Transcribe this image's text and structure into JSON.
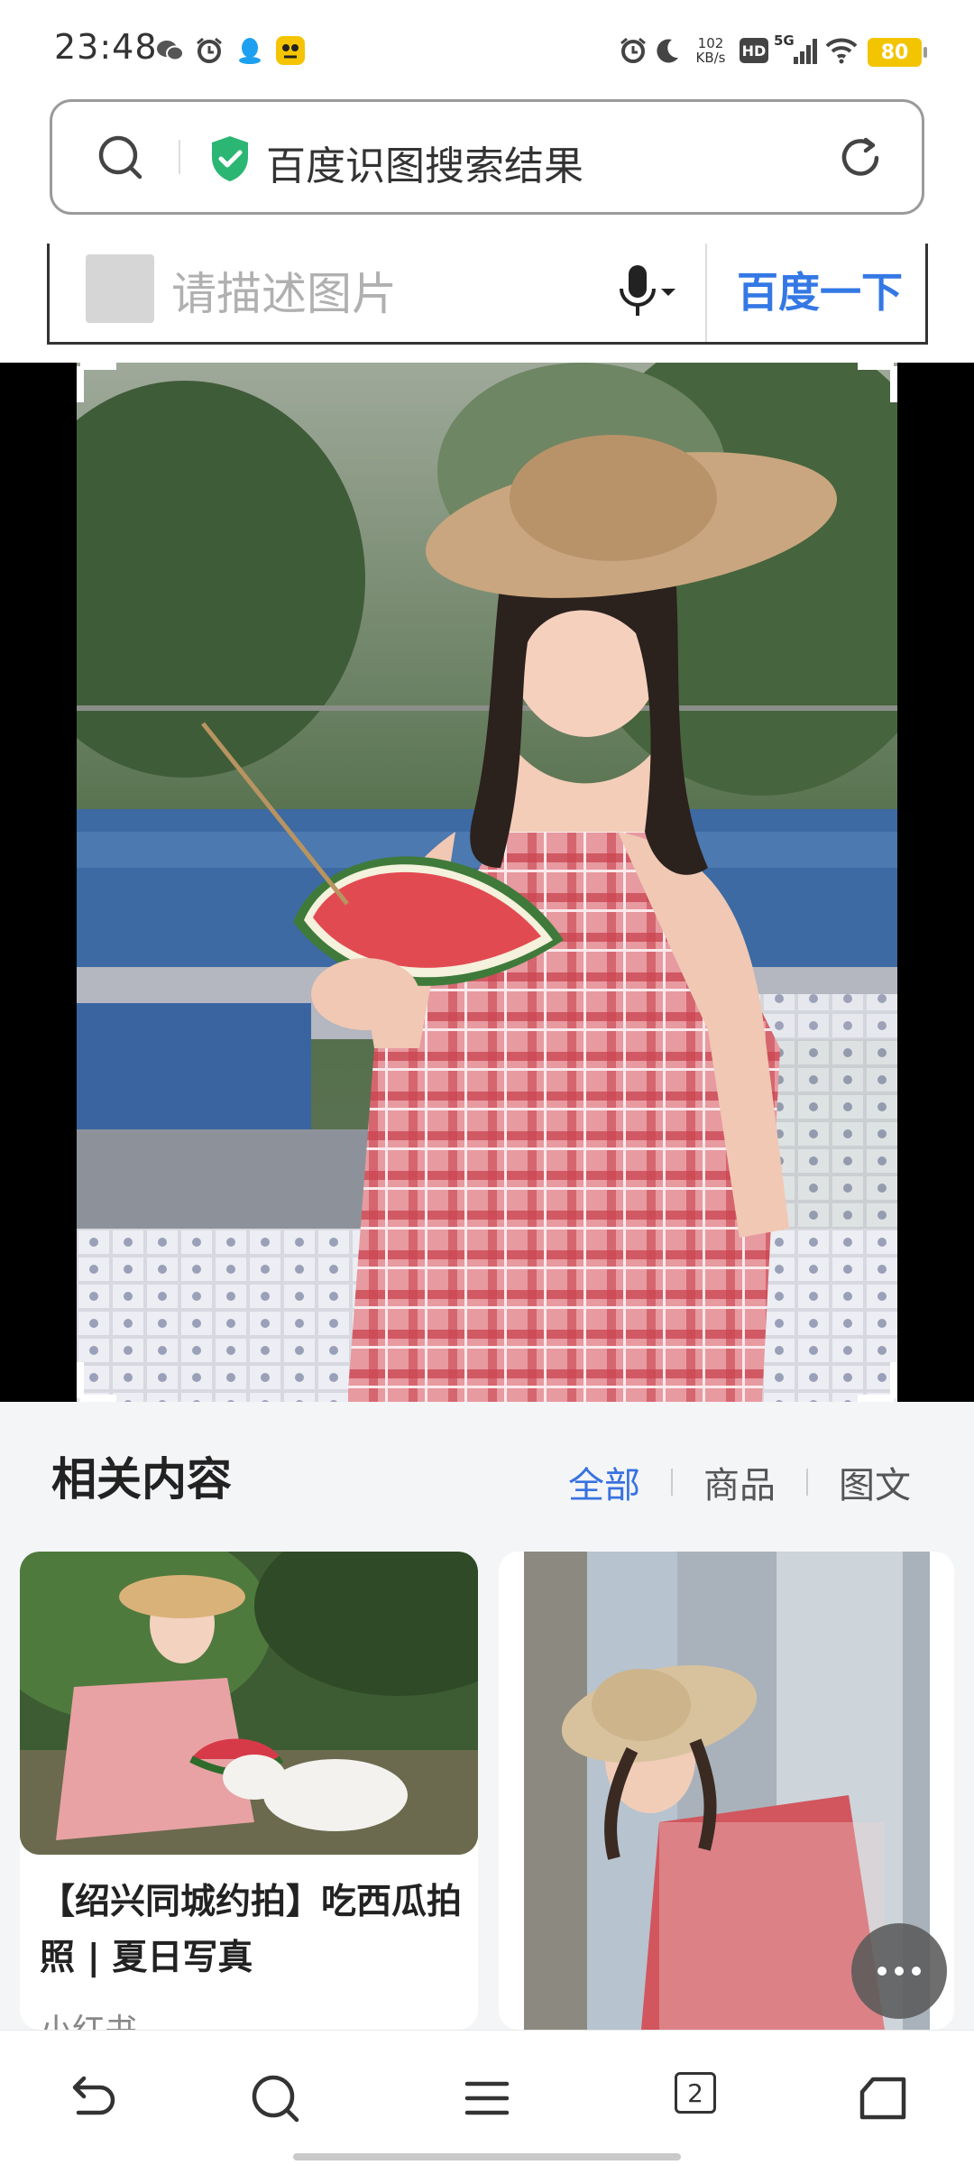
{
  "status_bar": {
    "time": "23:48",
    "net_speed_value": "102",
    "net_speed_unit": "KB/s",
    "hd_label": "HD",
    "network": "5G",
    "battery": "80",
    "left_icons": [
      "wechat-icon",
      "alarm-icon",
      "qq-icon",
      "app-icon"
    ],
    "right_icons": [
      "alarm-icon",
      "moon-icon",
      "hd-icon",
      "signal-icon",
      "wifi-icon",
      "battery-icon"
    ]
  },
  "address_bar": {
    "title": "百度识图搜索结果",
    "icons": [
      "search-icon",
      "shield-check-icon",
      "refresh-icon"
    ]
  },
  "baidu_search": {
    "placeholder": "请描述图片",
    "button": "百度一下",
    "icons": [
      "image-thumbnail",
      "microphone-icon",
      "dropdown-arrow-icon"
    ]
  },
  "related": {
    "title": "相关内容",
    "filters": [
      "全部",
      "商品",
      "图文"
    ],
    "active_filter": "全部",
    "cards": [
      {
        "title": "【绍兴同城约拍】吃西瓜拍照 | 夏日写真",
        "source": "小红书"
      },
      {
        "title": "",
        "source": ""
      }
    ]
  },
  "bottom_nav": {
    "tab_count": "2",
    "icons": [
      "back-icon",
      "search-icon",
      "menu-icon",
      "tabs-icon",
      "home-icon"
    ]
  },
  "colors": {
    "accent_blue": "#3478e5",
    "battery": "#f2c500",
    "shield_green": "#2bb673"
  }
}
